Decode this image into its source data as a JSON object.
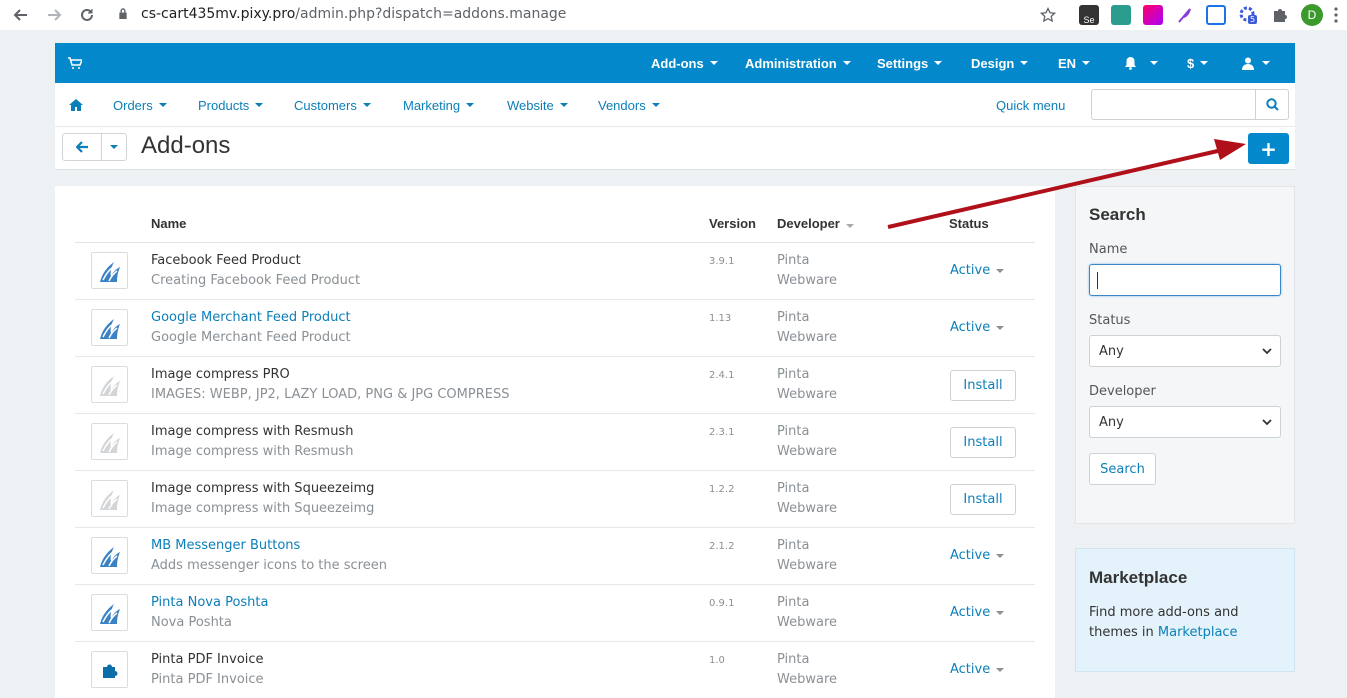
{
  "browser": {
    "url_host": "cs-cart435mv.pixy.pro",
    "url_path": "/admin.php?dispatch=addons.manage",
    "profile_initial": "D",
    "ext_badge": "5",
    "ext_se": "Se"
  },
  "topbar": {
    "items": [
      {
        "label": "Add-ons"
      },
      {
        "label": "Administration"
      },
      {
        "label": "Settings"
      },
      {
        "label": "Design"
      },
      {
        "label": "EN"
      },
      {
        "label": ""
      },
      {
        "label": "$"
      },
      {
        "label": ""
      }
    ]
  },
  "subnav": {
    "items": [
      "Orders",
      "Products",
      "Customers",
      "Marketing",
      "Website",
      "Vendors"
    ],
    "quick_menu": "Quick menu",
    "search_placeholder": ""
  },
  "page": {
    "title": "Add-ons",
    "add_label": "+"
  },
  "table": {
    "headers": {
      "name": "Name",
      "version": "Version",
      "developer": "Developer",
      "status": "Status"
    },
    "rows": [
      {
        "name": "Facebook Feed Product",
        "desc": "Creating Facebook Feed Product",
        "version": "3.9.1",
        "dev1": "Pinta",
        "dev2": "Webware",
        "status": "Active",
        "installed": true,
        "link": false,
        "icon": "blue"
      },
      {
        "name": "Google Merchant Feed Product",
        "desc": "Google Merchant Feed Product",
        "version": "1.13",
        "dev1": "Pinta",
        "dev2": "Webware",
        "status": "Active",
        "installed": true,
        "link": true,
        "icon": "blue"
      },
      {
        "name": "Image compress PRO",
        "desc": "IMAGES: WEBP, JP2, LAZY LOAD, PNG & JPG COMPRESS",
        "version": "2.4.1",
        "dev1": "Pinta",
        "dev2": "Webware",
        "status": "Install",
        "installed": false,
        "link": false,
        "icon": "grey"
      },
      {
        "name": "Image compress with Resmush",
        "desc": "Image compress with Resmush",
        "version": "2.3.1",
        "dev1": "Pinta",
        "dev2": "Webware",
        "status": "Install",
        "installed": false,
        "link": false,
        "icon": "grey"
      },
      {
        "name": "Image compress with Squeezeimg",
        "desc": "Image compress with Squeezeimg",
        "version": "1.2.2",
        "dev1": "Pinta",
        "dev2": "Webware",
        "status": "Install",
        "installed": false,
        "link": false,
        "icon": "grey"
      },
      {
        "name": "MB Messenger Buttons",
        "desc": "Adds messenger icons to the screen",
        "version": "2.1.2",
        "dev1": "Pinta",
        "dev2": "Webware",
        "status": "Active",
        "installed": true,
        "link": true,
        "icon": "blue"
      },
      {
        "name": "Pinta Nova Poshta",
        "desc": "Nova Poshta",
        "version": "0.9.1",
        "dev1": "Pinta",
        "dev2": "Webware",
        "status": "Active",
        "installed": true,
        "link": true,
        "icon": "blue"
      },
      {
        "name": "Pinta PDF Invoice",
        "desc": "Pinta PDF Invoice",
        "version": "1.0",
        "dev1": "Pinta",
        "dev2": "Webware",
        "status": "Active",
        "installed": true,
        "link": false,
        "icon": "puzzle"
      }
    ]
  },
  "search_panel": {
    "title": "Search",
    "name_label": "Name",
    "name_value": "",
    "status_label": "Status",
    "status_value": "Any",
    "developer_label": "Developer",
    "developer_value": "Any",
    "button": "Search"
  },
  "marketplace": {
    "title": "Marketplace",
    "text": "Find more add-ons and themes in ",
    "link": "Marketplace"
  },
  "colors": {
    "brand": "#0388cc",
    "link": "#0b7fb9",
    "annotation_arrow": "#b0101a"
  }
}
